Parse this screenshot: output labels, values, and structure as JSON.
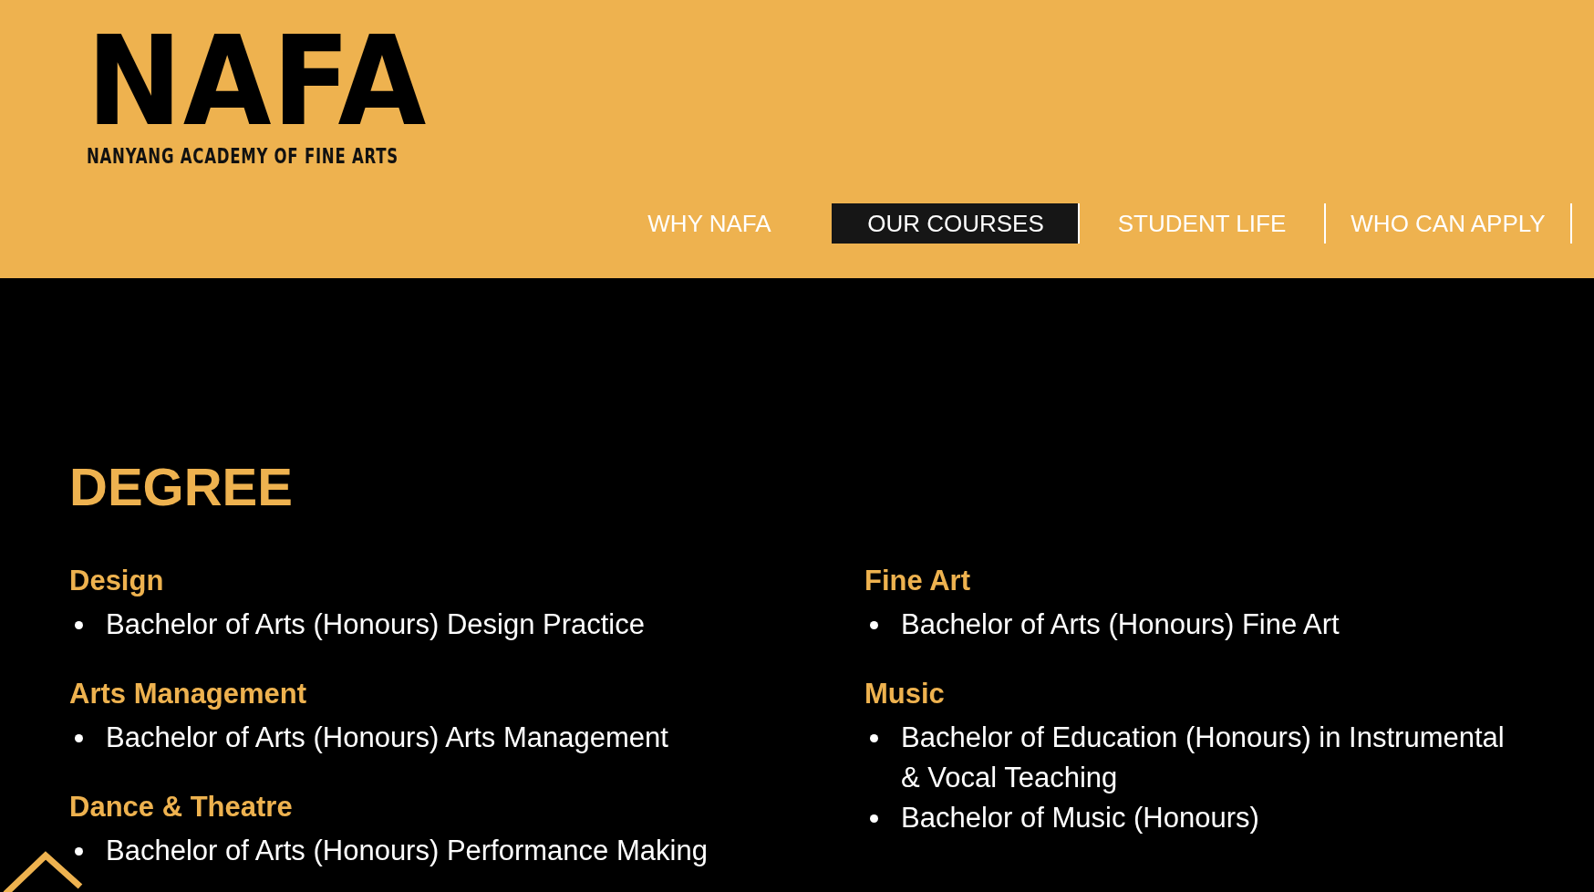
{
  "header": {
    "logo": {
      "wordmark": "NAFA",
      "subtitle": "NANYANG ACADEMY OF FINE ARTS"
    },
    "nav": [
      {
        "label": "WHY NAFA",
        "selected": false,
        "divider": false
      },
      {
        "label": "OUR COURSES",
        "selected": true,
        "divider": false
      },
      {
        "label": "STUDENT LIFE",
        "selected": false,
        "divider": true
      },
      {
        "label": "WHO CAN APPLY",
        "selected": false,
        "divider": true
      }
    ]
  },
  "section": {
    "title": "DEGREE",
    "columns": [
      [
        {
          "heading": "Design",
          "courses": [
            "Bachelor of Arts (Honours) Design Practice"
          ]
        },
        {
          "heading": "Arts Management",
          "courses": [
            "Bachelor of Arts (Honours) Arts Management"
          ]
        },
        {
          "heading": "Dance & Theatre",
          "courses": [
            "Bachelor of Arts (Honours) Performance Making"
          ]
        }
      ],
      [
        {
          "heading": "Fine Art",
          "courses": [
            "Bachelor of Arts (Honours) Fine Art"
          ]
        },
        {
          "heading": "Music",
          "courses": [
            "Bachelor of Education (Honours) in Instrumental & Vocal Teaching",
            "Bachelor of Music (Honours)"
          ]
        }
      ]
    ]
  }
}
